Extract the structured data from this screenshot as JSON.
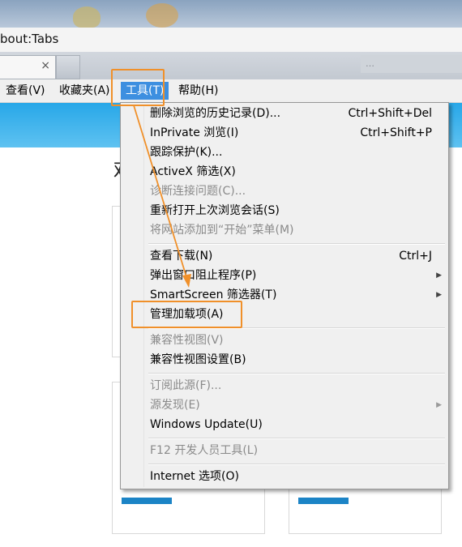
{
  "window": {
    "address_text": "bout:Tabs",
    "tab_close": "×",
    "ghost_tab_text": "…"
  },
  "menubar": {
    "items": [
      {
        "label": "查看(V)"
      },
      {
        "label": "收藏夹(A)"
      },
      {
        "label": "工具(T)"
      },
      {
        "label": "帮助(H)"
      }
    ]
  },
  "page": {
    "partial_char": "欢"
  },
  "tools_menu": {
    "items": [
      {
        "label": "删除浏览的历史记录(D)...",
        "shortcut": "Ctrl+Shift+Del",
        "disabled": false
      },
      {
        "label": "InPrivate 浏览(I)",
        "shortcut": "Ctrl+Shift+P",
        "disabled": false
      },
      {
        "label": "跟踪保护(K)...",
        "shortcut": "",
        "disabled": false
      },
      {
        "label": "ActiveX 筛选(X)",
        "shortcut": "",
        "disabled": false
      },
      {
        "label": "诊断连接问题(C)...",
        "shortcut": "",
        "disabled": true
      },
      {
        "label": "重新打开上次浏览会话(S)",
        "shortcut": "",
        "disabled": false
      },
      {
        "label": "将网站添加到“开始”菜单(M)",
        "shortcut": "",
        "disabled": true
      },
      {
        "label": "查看下载(N)",
        "shortcut": "Ctrl+J",
        "disabled": false
      },
      {
        "label": "弹出窗口阻止程序(P)",
        "shortcut": "",
        "disabled": false,
        "submenu": true
      },
      {
        "label": "SmartScreen 筛选器(T)",
        "shortcut": "",
        "disabled": false,
        "submenu": true
      },
      {
        "label": "管理加载项(A)",
        "shortcut": "",
        "disabled": false
      },
      {
        "label": "兼容性视图(V)",
        "shortcut": "",
        "disabled": true
      },
      {
        "label": "兼容性视图设置(B)",
        "shortcut": "",
        "disabled": false
      },
      {
        "label": "订阅此源(F)...",
        "shortcut": "",
        "disabled": true
      },
      {
        "label": "源发现(E)",
        "shortcut": "",
        "disabled": true,
        "submenu": true
      },
      {
        "label": "Windows Update(U)",
        "shortcut": "",
        "disabled": false
      },
      {
        "label": "F12 开发人员工具(L)",
        "shortcut": "",
        "disabled": true
      },
      {
        "label": "Internet 选项(O)",
        "shortcut": "",
        "disabled": false
      }
    ],
    "submenu_arrow": "▶"
  },
  "colors": {
    "highlight": "#f0902a",
    "menu_active": "#3d8fe0",
    "page_banner": "#27a7e8"
  }
}
